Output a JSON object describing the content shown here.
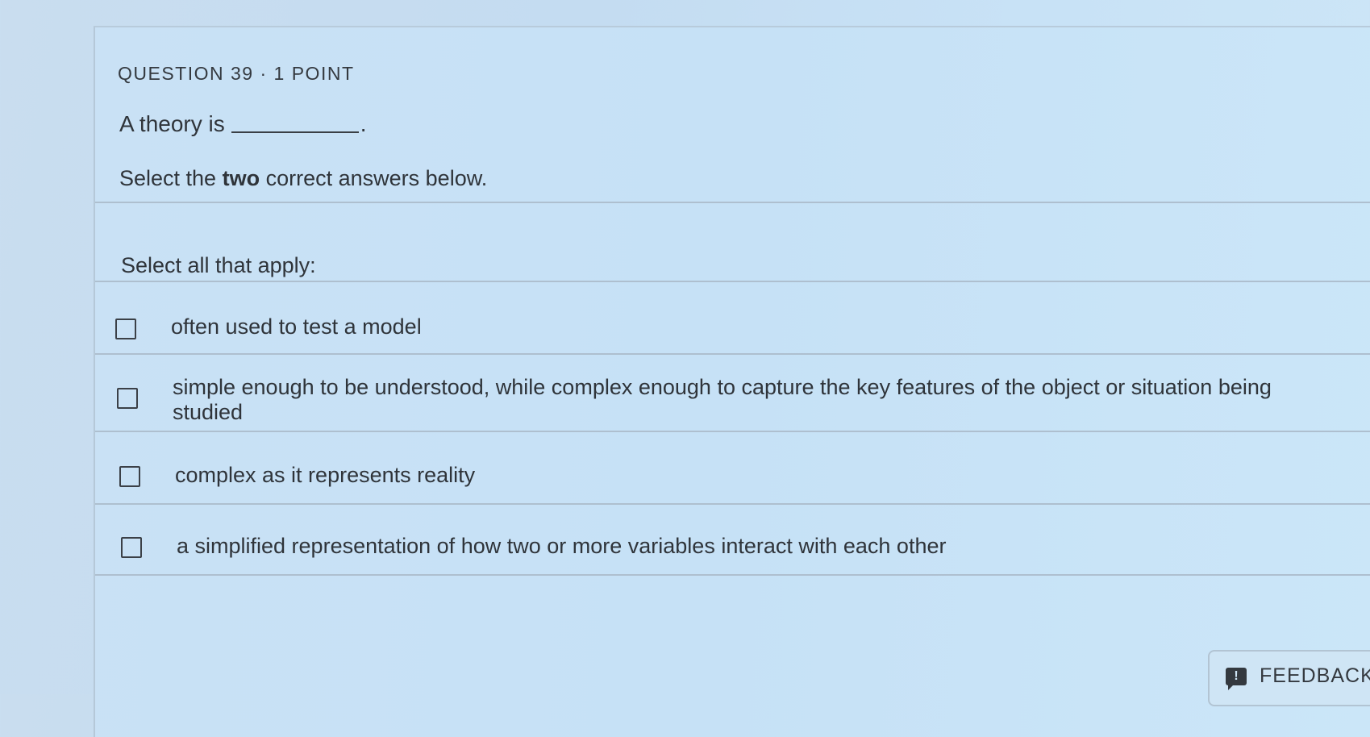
{
  "question": {
    "header": "QUESTION 39 · 1 POINT",
    "stem_prefix": "A theory is",
    "stem_suffix": ".",
    "instruction_prefix": "Select the",
    "instruction_emphasis": "two",
    "instruction_suffix": "correct answers below.",
    "select_label": "Select all that apply:"
  },
  "options": [
    {
      "text": "often used to test a model",
      "checked": false
    },
    {
      "text": "simple enough to be understood, while complex enough to capture the key features of the object or situation being studied",
      "checked": false
    },
    {
      "text": "complex as it represents reality",
      "checked": false
    },
    {
      "text": "a simplified representation of how two or more variables interact with each other",
      "checked": false
    }
  ],
  "feedback": {
    "label": "FEEDBACK",
    "icon": "feedback-exclamation-icon",
    "icon_glyph": "!"
  },
  "colors": {
    "background": "#c6dff3",
    "text": "#2f343a",
    "divider": "#aebfcf"
  }
}
